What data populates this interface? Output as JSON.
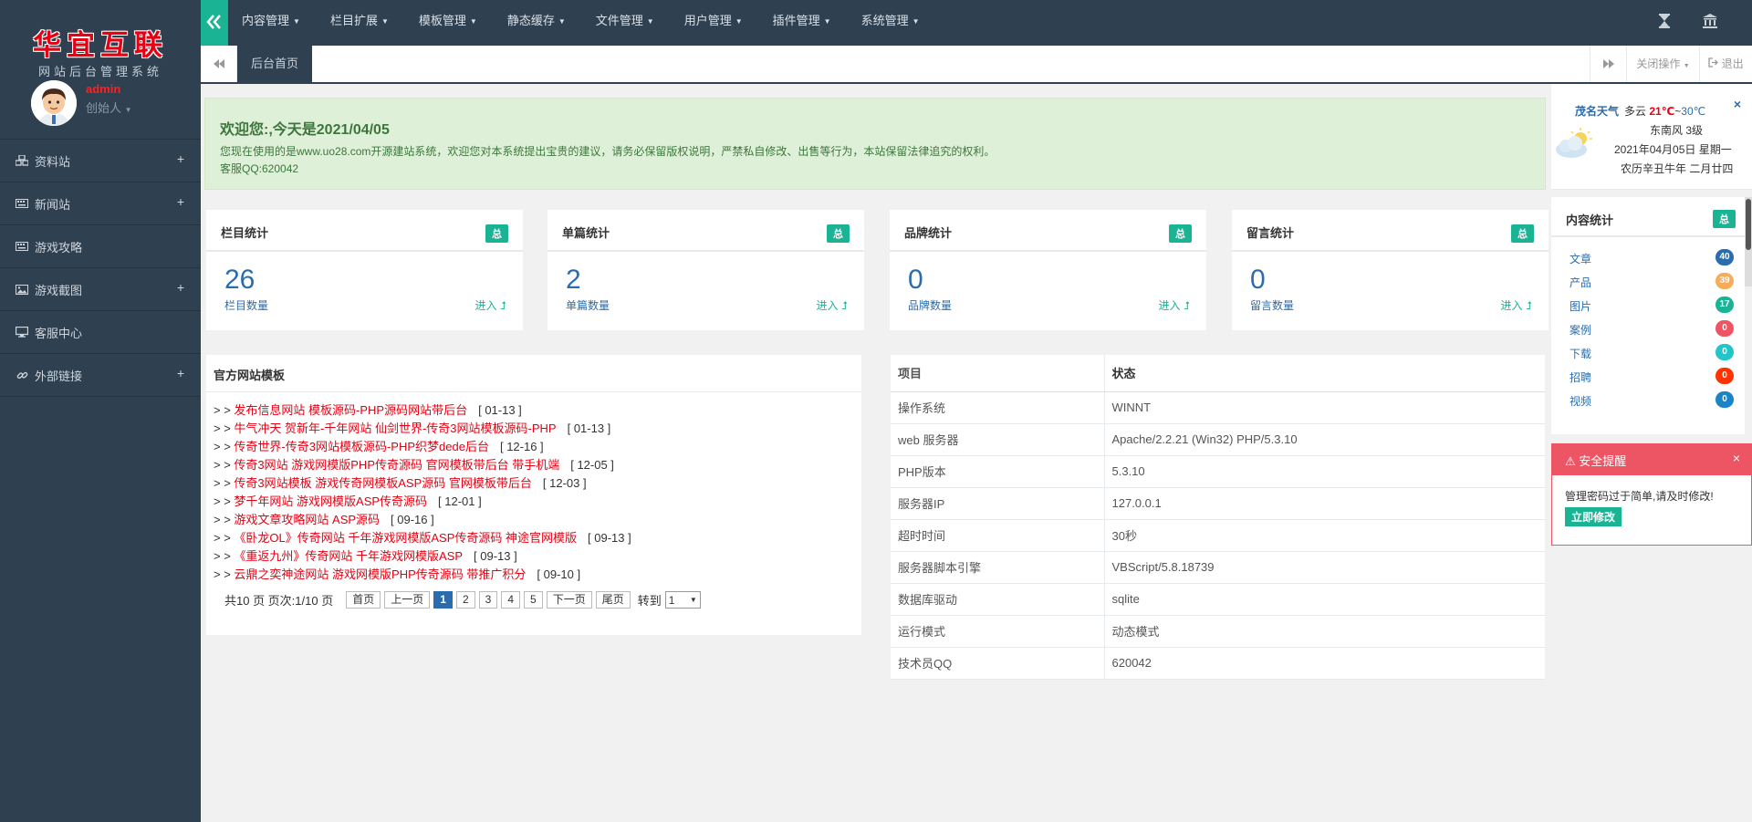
{
  "sidebar": {
    "brand_title": "华宜互联",
    "brand_subtitle": "网站后台管理系统",
    "user_name": "admin",
    "user_role": "创始人",
    "items": [
      {
        "label": "资料站",
        "icon": "cubes-icon",
        "expandable": "+"
      },
      {
        "label": "新闻站",
        "icon": "keyboard-icon",
        "expandable": "+"
      },
      {
        "label": "游戏攻略",
        "icon": "keyboard-icon",
        "expandable": ""
      },
      {
        "label": "游戏截图",
        "icon": "picture-icon",
        "expandable": "+"
      },
      {
        "label": "客服中心",
        "icon": "desktop-icon",
        "expandable": ""
      },
      {
        "label": "外部链接",
        "icon": "link-icon",
        "expandable": "+"
      }
    ]
  },
  "topnav": {
    "menus": [
      "内容管理",
      "栏目扩展",
      "模板管理",
      "静态缓存",
      "文件管理",
      "用户管理",
      "插件管理",
      "系统管理"
    ],
    "accent": "#1ab394",
    "bg": "#2f4050"
  },
  "tabs": {
    "active": "后台首页",
    "close_ops": "关闭操作",
    "logout": "退出"
  },
  "welcome": {
    "title": "欢迎您:,今天是2021/04/05",
    "line1": "您现在使用的是www.uo28.com开源建站系统，欢迎您对本系统提出宝贵的建议，请务必保留版权说明，严禁私自修改、出售等行为，本站保留法律追究的权利。",
    "line2": "客服QQ:620042"
  },
  "stats": [
    {
      "title": "栏目统计",
      "badge": "总",
      "value": "26",
      "label": "栏目数量",
      "enter": "进入"
    },
    {
      "title": "单篇统计",
      "badge": "总",
      "value": "2",
      "label": "单篇数量",
      "enter": "进入"
    },
    {
      "title": "品牌统计",
      "badge": "总",
      "value": "0",
      "label": "品牌数量",
      "enter": "进入"
    },
    {
      "title": "留言统计",
      "badge": "总",
      "value": "0",
      "label": "留言数量",
      "enter": "进入"
    }
  ],
  "templates": {
    "title": "官方网站模板",
    "items": [
      {
        "text": "发布信息网站 模板源码-PHP源码网站带后台",
        "date": "[ 01-13 ]"
      },
      {
        "text": "牛气冲天 贺新年-千年网站 仙剑世界-传奇3网站模板源码-PHP",
        "date": "[ 01-13 ]"
      },
      {
        "text": "传奇世界-传奇3网站模板源码-PHP织梦dede后台",
        "date": "[ 12-16 ]"
      },
      {
        "text": "传奇3网站 游戏网模版PHP传奇源码 官网模板带后台 带手机端",
        "date": "[ 12-05 ]"
      },
      {
        "text": "传奇3网站模板 游戏传奇网模板ASP源码 官网模板带后台",
        "date": "[ 12-03 ]"
      },
      {
        "text": "梦千年网站 游戏网模版ASP传奇源码",
        "date": "[ 12-01 ]"
      },
      {
        "text": "游戏文章攻略网站 ASP源码",
        "date": "[ 09-16 ]"
      },
      {
        "text": "《卧龙OL》传奇网站 千年游戏网模版ASP传奇源码 神途官网模版",
        "date": "[ 09-13 ]"
      },
      {
        "text": "《重返九州》传奇网站 千年游戏网模版ASP",
        "date": "[ 09-13 ]"
      },
      {
        "text": "云鼎之奕神途网站 游戏网模版PHP传奇源码 带推广积分",
        "date": "[ 09-10 ]"
      }
    ],
    "prefix": "> >",
    "pager": {
      "info": "共10 页 页次:1/10 页",
      "first": "首页",
      "prev": "上一页",
      "pages": [
        "1",
        "2",
        "3",
        "4",
        "5"
      ],
      "current": "1",
      "next": "下一页",
      "last": "尾页",
      "goto": "转到",
      "goto_value": "1"
    }
  },
  "system": {
    "header_item": "项目",
    "header_status": "状态",
    "rows": [
      {
        "k": "操作系统",
        "v": "WINNT"
      },
      {
        "k": "web 服务器",
        "v": "Apache/2.2.21 (Win32) PHP/5.3.10"
      },
      {
        "k": "PHP版本",
        "v": "5.3.10"
      },
      {
        "k": "服务器IP",
        "v": "127.0.0.1"
      },
      {
        "k": "超时时间",
        "v": "30秒"
      },
      {
        "k": "服务器脚本引擎",
        "v": "VBScript/5.8.18739"
      },
      {
        "k": "数据库驱动",
        "v": "sqlite"
      },
      {
        "k": "运行模式",
        "v": "动态模式"
      },
      {
        "k": "技术员QQ",
        "v": "620042"
      }
    ]
  },
  "weather": {
    "city": "茂名天气",
    "condition": "多云",
    "temp_low": "21℃",
    "sep": "~",
    "temp_high": "30℃",
    "wind": "东南风 3级",
    "date": "2021年04月05日 星期一",
    "lunar": "农历辛丑牛年 二月廿四",
    "close": "×"
  },
  "content_stats": {
    "title": "内容统计",
    "badge": "总",
    "items": [
      {
        "label": "文章",
        "count": "40",
        "color": "#2a6cad"
      },
      {
        "label": "产品",
        "count": "39",
        "color": "#f8ac59"
      },
      {
        "label": "图片",
        "count": "17",
        "color": "#1ab394"
      },
      {
        "label": "案例",
        "count": "0",
        "color": "#ed5565"
      },
      {
        "label": "下载",
        "count": "0",
        "color": "#23c6c8"
      },
      {
        "label": "招聘",
        "count": "0",
        "color": "#ff3300"
      },
      {
        "label": "视频",
        "count": "0",
        "color": "#1c84c6"
      }
    ]
  },
  "alert": {
    "title": "安全提醒",
    "message": "管理密码过于简单,请及时修改!",
    "button": "立即修改",
    "close": "×"
  }
}
